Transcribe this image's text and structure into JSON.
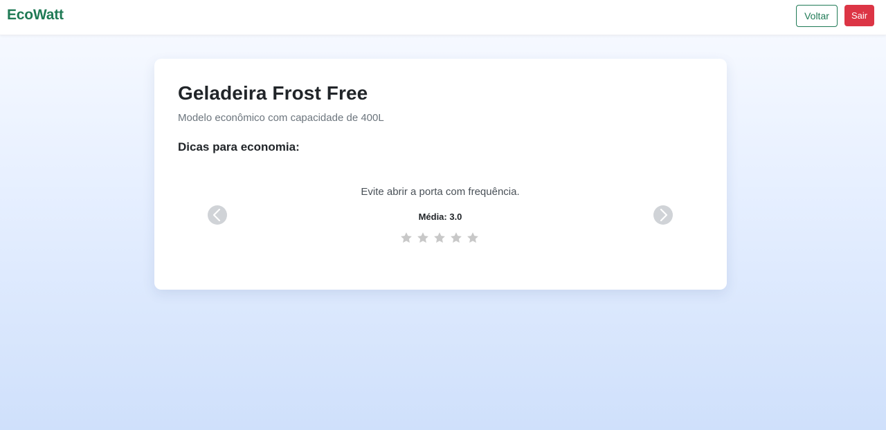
{
  "navbar": {
    "brand": "EcoWatt",
    "back_label": "Voltar",
    "logout_label": "Sair"
  },
  "card": {
    "title": "Geladeira Frost Free",
    "subtitle": "Modelo econômico com capacidade de 400L",
    "tips_heading": "Dicas para economia:"
  },
  "carousel": {
    "tip": "Evite abrir a porta com frequência.",
    "rating_label": "Média: 3.0",
    "rating_value": 3.0,
    "stars_total": 5,
    "stars_filled": 0,
    "prev_icon": "chevron-left-icon",
    "next_icon": "chevron-right-icon"
  },
  "colors": {
    "brand": "#1f7a55",
    "danger": "#dc3545",
    "star_empty": "#c8c8c8",
    "arrow_bg": "#d0d3d7"
  }
}
